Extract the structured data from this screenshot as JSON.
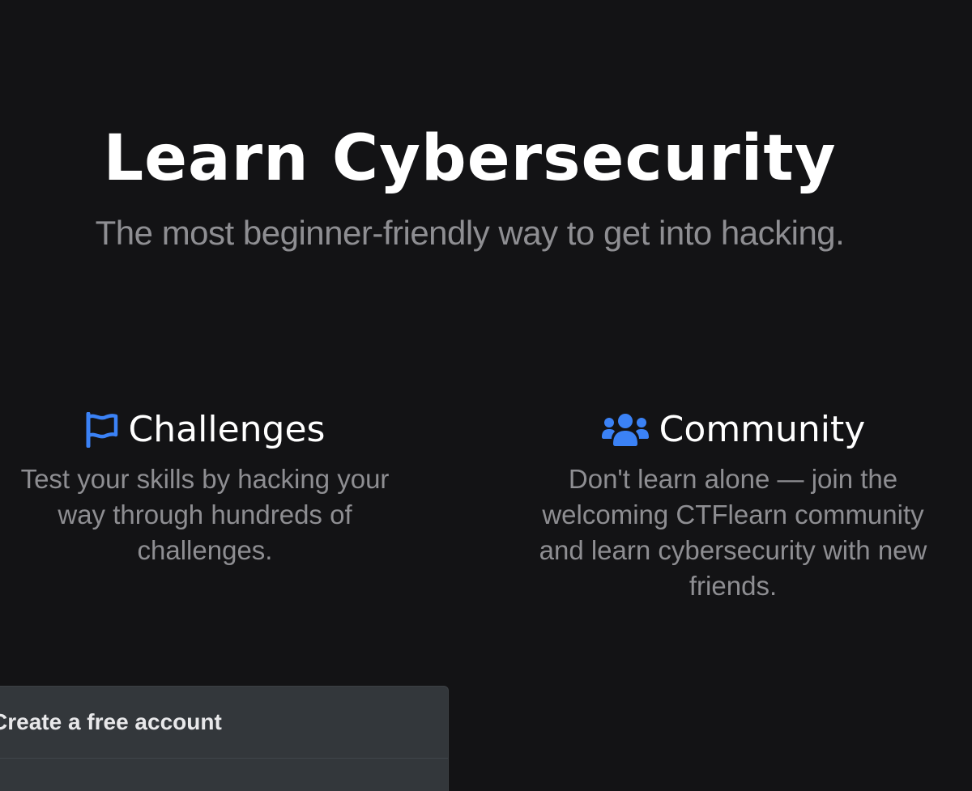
{
  "hero": {
    "title": "Learn Cybersecurity",
    "subtitle": "The most beginner-friendly way to get into hacking."
  },
  "features": [
    {
      "icon": "flag-icon",
      "title": "Challenges",
      "description": "Test your skills by hacking your way through hundreds of challenges."
    },
    {
      "icon": "users-icon",
      "title": "Community",
      "description": "Don't learn alone — join the welcoming CTFlearn community and learn cybersecurity with new friends."
    }
  ],
  "signup": {
    "title": "Create a free account"
  },
  "colors": {
    "background": "#131315",
    "accent": "#3b82f6",
    "muted_text": "#8e8e92",
    "card": "#33373b"
  }
}
